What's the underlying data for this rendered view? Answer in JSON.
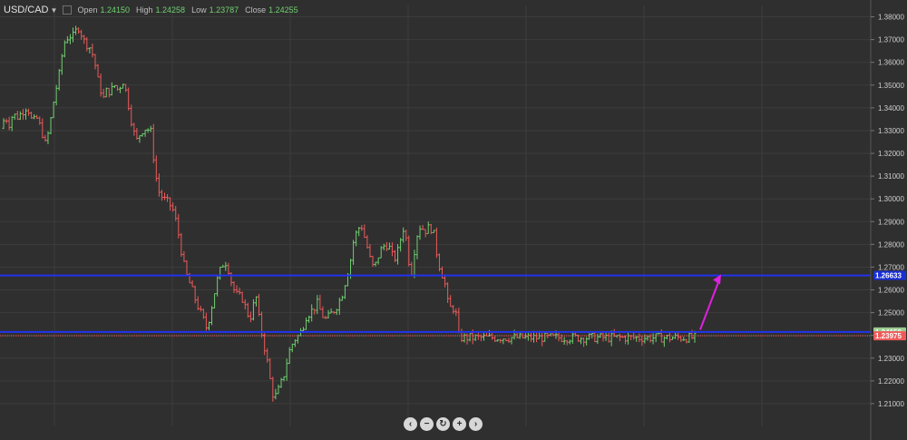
{
  "header": {
    "symbol": "USD/CAD",
    "open_label": "Open",
    "open_value": "1.24150",
    "high_label": "High",
    "high_value": "1.24258",
    "low_label": "Low",
    "low_value": "1.23787",
    "close_label": "Close",
    "close_value": "1.24255"
  },
  "icons": {
    "symbol_dropdown": "caret-down-icon",
    "checkbox": "checkbox-icon",
    "nav": [
      "chevron-left-icon",
      "minus-icon",
      "refresh-icon",
      "plus-icon",
      "chevron-right-icon"
    ]
  },
  "nav_glyphs": [
    "‹",
    "−",
    "↻",
    "+",
    "›"
  ],
  "colors": {
    "background": "#2f2f2f",
    "grid": "#3c3c3c",
    "up_bar": "#6fd06f",
    "down_bar": "#ee5a5a",
    "horizontal_line": "#2233ee",
    "arrow": "#e020e0",
    "price_tag_blue": "#1a2fd6",
    "price_tag_green": "#9acb8f"
  },
  "chart_data": {
    "type": "ohlc",
    "title": "USD/CAD",
    "xlabel": "",
    "ylabel": "",
    "y_range": [
      1.2,
      1.385
    ],
    "y_ticks": [
      "1.38000",
      "1.37000",
      "1.36000",
      "1.35000",
      "1.34000",
      "1.33000",
      "1.32000",
      "1.31000",
      "1.30000",
      "1.29000",
      "1.28000",
      "1.27000",
      "1.26000",
      "1.25000",
      "1.24000",
      "1.23000",
      "1.22000",
      "1.21000"
    ],
    "grid": true,
    "bar_count": 250,
    "path_points": [
      [
        0,
        1.331
      ],
      [
        6,
        1.336
      ],
      [
        10,
        1.333
      ],
      [
        14,
        1.337
      ],
      [
        20,
        1.336
      ],
      [
        24,
        1.338
      ],
      [
        30,
        1.341
      ],
      [
        36,
        1.333
      ],
      [
        40,
        1.336
      ],
      [
        46,
        1.33
      ],
      [
        50,
        1.324
      ],
      [
        54,
        1.33
      ],
      [
        60,
        1.345
      ],
      [
        66,
        1.356
      ],
      [
        70,
        1.368
      ],
      [
        76,
        1.372
      ],
      [
        80,
        1.371
      ],
      [
        84,
        1.374
      ],
      [
        88,
        1.376
      ],
      [
        91,
        1.37
      ],
      [
        96,
        1.368
      ],
      [
        100,
        1.366
      ],
      [
        104,
        1.361
      ],
      [
        108,
        1.352
      ],
      [
        114,
        1.344
      ],
      [
        118,
        1.348
      ],
      [
        122,
        1.347
      ],
      [
        126,
        1.35
      ],
      [
        130,
        1.348
      ],
      [
        136,
        1.352
      ],
      [
        140,
        1.345
      ],
      [
        146,
        1.332
      ],
      [
        150,
        1.325
      ],
      [
        156,
        1.33
      ],
      [
        160,
        1.331
      ],
      [
        166,
        1.33
      ],
      [
        170,
        1.316
      ],
      [
        174,
        1.304
      ],
      [
        180,
        1.3
      ],
      [
        186,
        1.298
      ],
      [
        190,
        1.296
      ],
      [
        194,
        1.29
      ],
      [
        198,
        1.282
      ],
      [
        202,
        1.272
      ],
      [
        206,
        1.266
      ],
      [
        210,
        1.262
      ],
      [
        216,
        1.255
      ],
      [
        220,
        1.251
      ],
      [
        226,
        1.245
      ],
      [
        228,
        1.243
      ],
      [
        232,
        1.25
      ],
      [
        236,
        1.258
      ],
      [
        240,
        1.265
      ],
      [
        244,
        1.27
      ],
      [
        248,
        1.273
      ],
      [
        252,
        1.269
      ],
      [
        256,
        1.262
      ],
      [
        260,
        1.258
      ],
      [
        264,
        1.257
      ],
      [
        268,
        1.256
      ],
      [
        272,
        1.25
      ],
      [
        276,
        1.248
      ],
      [
        280,
        1.254
      ],
      [
        282,
        1.258
      ],
      [
        286,
        1.246
      ],
      [
        290,
        1.238
      ],
      [
        294,
        1.23
      ],
      [
        298,
        1.22
      ],
      [
        302,
        1.212
      ],
      [
        306,
        1.215
      ],
      [
        310,
        1.219
      ],
      [
        314,
        1.224
      ],
      [
        318,
        1.232
      ],
      [
        322,
        1.236
      ],
      [
        326,
        1.239
      ],
      [
        330,
        1.24
      ],
      [
        334,
        1.244
      ],
      [
        338,
        1.249
      ],
      [
        342,
        1.25
      ],
      [
        346,
        1.252
      ],
      [
        350,
        1.254
      ],
      [
        354,
        1.25
      ],
      [
        358,
        1.247
      ],
      [
        362,
        1.248
      ],
      [
        366,
        1.25
      ],
      [
        370,
        1.252
      ],
      [
        374,
        1.255
      ],
      [
        378,
        1.259
      ],
      [
        382,
        1.266
      ],
      [
        386,
        1.272
      ],
      [
        390,
        1.282
      ],
      [
        394,
        1.286
      ],
      [
        398,
        1.289
      ],
      [
        402,
        1.283
      ],
      [
        406,
        1.277
      ],
      [
        410,
        1.27
      ],
      [
        414,
        1.271
      ],
      [
        418,
        1.276
      ],
      [
        422,
        1.279
      ],
      [
        426,
        1.28
      ],
      [
        430,
        1.278
      ],
      [
        434,
        1.273
      ],
      [
        438,
        1.276
      ],
      [
        442,
        1.283
      ],
      [
        446,
        1.289
      ],
      [
        450,
        1.274
      ],
      [
        454,
        1.268
      ],
      [
        458,
        1.281
      ],
      [
        462,
        1.288
      ],
      [
        466,
        1.287
      ],
      [
        470,
        1.286
      ],
      [
        474,
        1.288
      ],
      [
        478,
        1.285
      ],
      [
        482,
        1.275
      ],
      [
        486,
        1.268
      ],
      [
        490,
        1.265
      ],
      [
        492,
        1.256
      ],
      [
        496,
        1.252
      ],
      [
        500,
        1.252
      ],
      [
        504,
        1.248
      ],
      [
        506,
        1.239
      ]
    ],
    "horizontal_lines": [
      {
        "value": 1.26633,
        "label": "1.26633",
        "color": "#2233ee"
      },
      {
        "value": 1.2415,
        "label": "1.24150",
        "color": "#2233ee"
      }
    ],
    "price_tags": [
      {
        "value": 1.26633,
        "label": "1.26633",
        "bg": "#1a2fd6",
        "fg": "#ffffff"
      },
      {
        "value": 1.2415,
        "label": "1.24150",
        "bg": "#9acb8f",
        "fg": "#ffffff"
      },
      {
        "value": 1.2398,
        "label": "1.23975",
        "bg": "#ee5a5a",
        "fg": "#ffffff"
      }
    ],
    "annotation_arrow": {
      "from": [
        1.242
      ],
      "to": [
        1.267
      ],
      "color": "#e020e0"
    }
  }
}
